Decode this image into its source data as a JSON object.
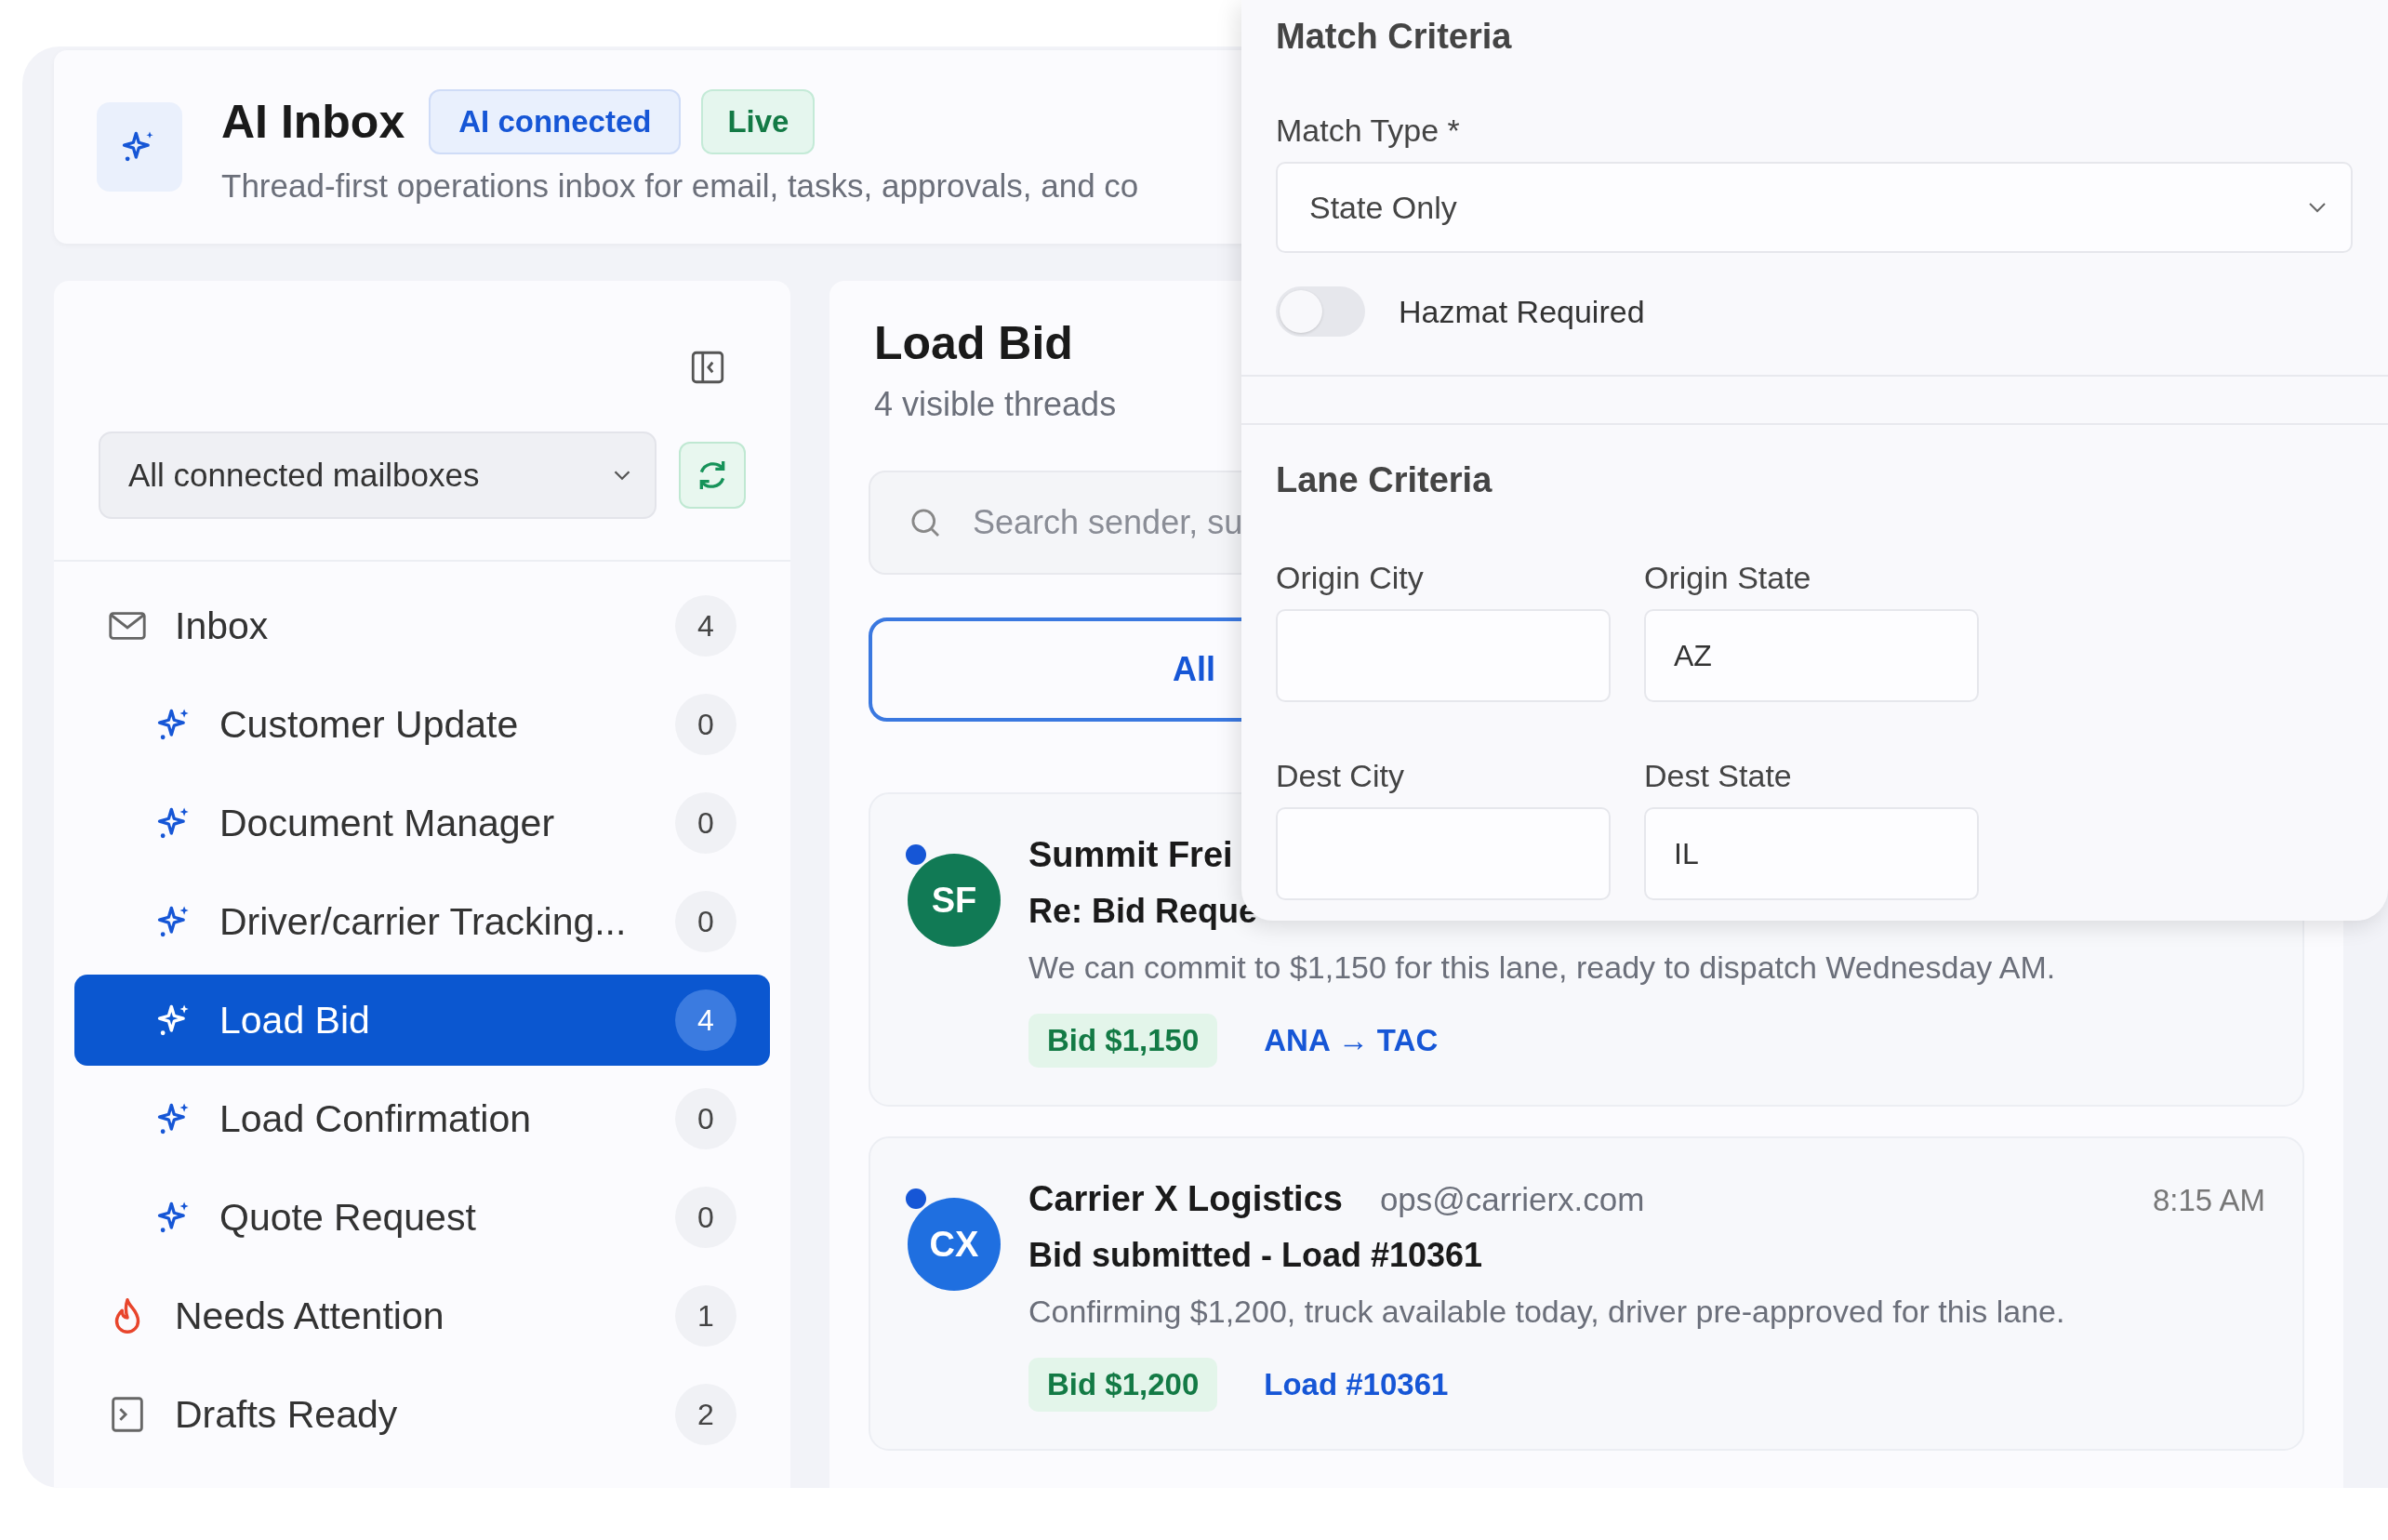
{
  "header": {
    "title": "AI Inbox",
    "badges": [
      {
        "label": "AI connected",
        "kind": "info"
      },
      {
        "label": "Live",
        "kind": "live"
      }
    ],
    "description": "Thread-first operations inbox for email, tasks, approvals, and co"
  },
  "sidebar": {
    "mailbox_select": "All connected mailboxes",
    "items": [
      {
        "label": "Inbox",
        "count": "4",
        "selected": false,
        "children": [
          {
            "label": "Customer Update",
            "count": "0",
            "selected": false
          },
          {
            "label": "Document Manager",
            "count": "0",
            "selected": false
          },
          {
            "label": "Driver/carrier Tracking...",
            "count": "0",
            "selected": false
          },
          {
            "label": "Load Bid",
            "count": "4",
            "selected": true
          },
          {
            "label": "Load Confirmation",
            "count": "0",
            "selected": false
          },
          {
            "label": "Quote Request",
            "count": "0",
            "selected": false
          }
        ]
      },
      {
        "label": "Needs Attention",
        "count": "1",
        "selected": false
      },
      {
        "label": "Drafts Ready",
        "count": "2",
        "selected": false
      }
    ]
  },
  "thread_list": {
    "title": "Load Bid",
    "subtitle": "4 visible threads",
    "search": {
      "placeholder": "Search sender, su"
    },
    "tabs": [
      {
        "label": "All",
        "selected": true
      }
    ],
    "threads": [
      {
        "initials": "SF",
        "color": "#117a55",
        "unread": true,
        "sender": "Summit Frei",
        "subject": "Re: Bid Reque",
        "preview": "We can commit to $1,150 for this lane, ready to dispatch Wednesday AM.",
        "tags": [
          {
            "label": "Bid $1,150",
            "kind": "amount"
          },
          {
            "label": "ANA → TAC",
            "kind": "link"
          }
        ]
      },
      {
        "initials": "CX",
        "color": "#1f6fe0",
        "unread": true,
        "sender": "Carrier X Logistics",
        "email": "ops@carrierx.com",
        "time": "8:15 AM",
        "subject": "Bid submitted - Load #10361",
        "preview": "Confirming $1,200, truck available today, driver pre-approved for this lane.",
        "tags": [
          {
            "label": "Bid $1,200",
            "kind": "amount"
          },
          {
            "label": "Load #10361",
            "kind": "link"
          }
        ]
      }
    ]
  },
  "criteria_panel": {
    "match_criteria": {
      "title": "Match Criteria",
      "match_type": {
        "label": "Match Type *",
        "value": "State Only"
      },
      "toggle": {
        "label": "Hazmat Required",
        "on": false
      }
    },
    "lane_criteria": {
      "title": "Lane Criteria",
      "fields": [
        {
          "label": "Origin City"
        },
        {
          "label": "Origin State",
          "value": "AZ"
        },
        {
          "label": "Dest City"
        },
        {
          "label": "Dest State",
          "value": "IL"
        }
      ]
    }
  }
}
